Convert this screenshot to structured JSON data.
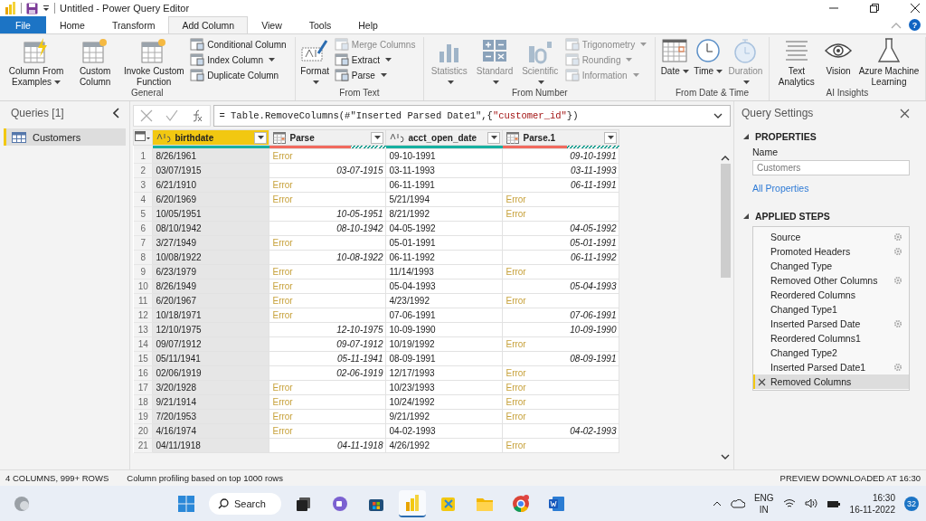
{
  "window": {
    "title": "Untitled - Power Query Editor",
    "help_label": "?"
  },
  "tabs": [
    {
      "label": "File",
      "selected": false,
      "kind": "file"
    },
    {
      "label": "Home",
      "selected": false,
      "kind": "tab"
    },
    {
      "label": "Transform",
      "selected": false,
      "kind": "tab"
    },
    {
      "label": "Add Column",
      "selected": true,
      "kind": "tab"
    },
    {
      "label": "View",
      "selected": false,
      "kind": "tab"
    },
    {
      "label": "Tools",
      "selected": false,
      "kind": "tab"
    },
    {
      "label": "Help",
      "selected": false,
      "kind": "tab"
    }
  ],
  "ribbon": [
    {
      "label": "General",
      "items": [
        {
          "kind": "large",
          "label": "Column From Examples",
          "dropdown": true,
          "disabled": false
        },
        {
          "kind": "large",
          "label": "Custom Column",
          "dropdown": false,
          "disabled": false
        },
        {
          "kind": "large",
          "label": "Invoke Custom Function",
          "dropdown": false,
          "disabled": false
        },
        {
          "kind": "stack",
          "items": [
            {
              "label": "Conditional Column",
              "dropdown": false,
              "disabled": false
            },
            {
              "label": "Index Column",
              "dropdown": true,
              "disabled": false
            },
            {
              "label": "Duplicate Column",
              "dropdown": false,
              "disabled": false
            }
          ]
        }
      ]
    },
    {
      "label": "From Text",
      "items": [
        {
          "kind": "large",
          "label": "Format",
          "dropdown": true,
          "disabled": false
        },
        {
          "kind": "stack",
          "items": [
            {
              "label": "Merge Columns",
              "dropdown": false,
              "disabled": true
            },
            {
              "label": "Extract",
              "dropdown": true,
              "disabled": false
            },
            {
              "label": "Parse",
              "dropdown": true,
              "disabled": false
            }
          ]
        }
      ]
    },
    {
      "label": "From Number",
      "items": [
        {
          "kind": "large",
          "label": "Statistics",
          "dropdown": true,
          "disabled": true
        },
        {
          "kind": "large",
          "label": "Standard",
          "dropdown": true,
          "disabled": true
        },
        {
          "kind": "large",
          "label": "Scientific",
          "dropdown": true,
          "disabled": true
        },
        {
          "kind": "stack",
          "items": [
            {
              "label": "Trigonometry",
              "dropdown": true,
              "disabled": true
            },
            {
              "label": "Rounding",
              "dropdown": true,
              "disabled": true
            },
            {
              "label": "Information",
              "dropdown": true,
              "disabled": true
            }
          ]
        }
      ]
    },
    {
      "label": "From Date & Time",
      "items": [
        {
          "kind": "large",
          "label": "Date",
          "dropdown": true,
          "disabled": false
        },
        {
          "kind": "large",
          "label": "Time",
          "dropdown": true,
          "disabled": false
        },
        {
          "kind": "large",
          "label": "Duration",
          "dropdown": true,
          "disabled": true
        }
      ]
    },
    {
      "label": "AI Insights",
      "items": [
        {
          "kind": "large",
          "label": "Text Analytics",
          "dropdown": false,
          "disabled": false
        },
        {
          "kind": "large",
          "label": "Vision",
          "dropdown": false,
          "disabled": false
        },
        {
          "kind": "large",
          "label": "Azure Machine Learning",
          "dropdown": false,
          "disabled": false
        }
      ]
    }
  ],
  "queries": {
    "title": "Queries [1]",
    "items": [
      {
        "label": "Customers",
        "selected": true
      }
    ]
  },
  "formula": [
    {
      "text": "= Table.RemoveColumns(#\"Inserted Parsed Date1\",{",
      "kind": "code"
    },
    {
      "text": "\"customer_id\"",
      "kind": "string"
    },
    {
      "text": "})",
      "kind": "code"
    }
  ],
  "table": {
    "columns": [
      {
        "name": "birthdate",
        "selected": true,
        "quality": {
          "kind": "valid",
          "level": 1
        }
      },
      {
        "name": "Parse",
        "selected": false,
        "quality": {
          "kind": "error",
          "level": 0.7
        }
      },
      {
        "name": "acct_open_date",
        "selected": false,
        "quality": {
          "kind": "valid",
          "level": 1
        }
      },
      {
        "name": "Parse.1",
        "selected": false,
        "quality": {
          "kind": "error",
          "level": 0.55
        }
      }
    ],
    "rows": [
      {
        "index": "1",
        "cells": [
          {
            "text": "8/26/1961",
            "kind": "text"
          },
          {
            "text": "Error",
            "kind": "error"
          },
          {
            "text": "09-10-1991",
            "kind": "text"
          },
          {
            "text": "09-10-1991",
            "kind": "date"
          }
        ]
      },
      {
        "index": "2",
        "cells": [
          {
            "text": "03/07/1915",
            "kind": "text"
          },
          {
            "text": "03-07-1915",
            "kind": "date"
          },
          {
            "text": "03-11-1993",
            "kind": "text"
          },
          {
            "text": "03-11-1993",
            "kind": "date"
          }
        ]
      },
      {
        "index": "3",
        "cells": [
          {
            "text": "6/21/1910",
            "kind": "text"
          },
          {
            "text": "Error",
            "kind": "error"
          },
          {
            "text": "06-11-1991",
            "kind": "text"
          },
          {
            "text": "06-11-1991",
            "kind": "date"
          }
        ]
      },
      {
        "index": "4",
        "cells": [
          {
            "text": "6/20/1969",
            "kind": "text"
          },
          {
            "text": "Error",
            "kind": "error"
          },
          {
            "text": "5/21/1994",
            "kind": "text"
          },
          {
            "text": "Error",
            "kind": "error"
          }
        ]
      },
      {
        "index": "5",
        "cells": [
          {
            "text": "10/05/1951",
            "kind": "text"
          },
          {
            "text": "10-05-1951",
            "kind": "date"
          },
          {
            "text": "8/21/1992",
            "kind": "text"
          },
          {
            "text": "Error",
            "kind": "error"
          }
        ]
      },
      {
        "index": "6",
        "cells": [
          {
            "text": "08/10/1942",
            "kind": "text"
          },
          {
            "text": "08-10-1942",
            "kind": "date"
          },
          {
            "text": "04-05-1992",
            "kind": "text"
          },
          {
            "text": "04-05-1992",
            "kind": "date"
          }
        ]
      },
      {
        "index": "7",
        "cells": [
          {
            "text": "3/27/1949",
            "kind": "text"
          },
          {
            "text": "Error",
            "kind": "error"
          },
          {
            "text": "05-01-1991",
            "kind": "text"
          },
          {
            "text": "05-01-1991",
            "kind": "date"
          }
        ]
      },
      {
        "index": "8",
        "cells": [
          {
            "text": "10/08/1922",
            "kind": "text"
          },
          {
            "text": "10-08-1922",
            "kind": "date"
          },
          {
            "text": "06-11-1992",
            "kind": "text"
          },
          {
            "text": "06-11-1992",
            "kind": "date"
          }
        ]
      },
      {
        "index": "9",
        "cells": [
          {
            "text": "6/23/1979",
            "kind": "text"
          },
          {
            "text": "Error",
            "kind": "error"
          },
          {
            "text": "11/14/1993",
            "kind": "text"
          },
          {
            "text": "Error",
            "kind": "error"
          }
        ]
      },
      {
        "index": "10",
        "cells": [
          {
            "text": "8/26/1949",
            "kind": "text"
          },
          {
            "text": "Error",
            "kind": "error"
          },
          {
            "text": "05-04-1993",
            "kind": "text"
          },
          {
            "text": "05-04-1993",
            "kind": "date"
          }
        ]
      },
      {
        "index": "11",
        "cells": [
          {
            "text": "6/20/1967",
            "kind": "text"
          },
          {
            "text": "Error",
            "kind": "error"
          },
          {
            "text": "4/23/1992",
            "kind": "text"
          },
          {
            "text": "Error",
            "kind": "error"
          }
        ]
      },
      {
        "index": "12",
        "cells": [
          {
            "text": "10/18/1971",
            "kind": "text"
          },
          {
            "text": "Error",
            "kind": "error"
          },
          {
            "text": "07-06-1991",
            "kind": "text"
          },
          {
            "text": "07-06-1991",
            "kind": "date"
          }
        ]
      },
      {
        "index": "13",
        "cells": [
          {
            "text": "12/10/1975",
            "kind": "text"
          },
          {
            "text": "12-10-1975",
            "kind": "date"
          },
          {
            "text": "10-09-1990",
            "kind": "text"
          },
          {
            "text": "10-09-1990",
            "kind": "date"
          }
        ]
      },
      {
        "index": "14",
        "cells": [
          {
            "text": "09/07/1912",
            "kind": "text"
          },
          {
            "text": "09-07-1912",
            "kind": "date"
          },
          {
            "text": "10/19/1992",
            "kind": "text"
          },
          {
            "text": "Error",
            "kind": "error"
          }
        ]
      },
      {
        "index": "15",
        "cells": [
          {
            "text": "05/11/1941",
            "kind": "text"
          },
          {
            "text": "05-11-1941",
            "kind": "date"
          },
          {
            "text": "08-09-1991",
            "kind": "text"
          },
          {
            "text": "08-09-1991",
            "kind": "date"
          }
        ]
      },
      {
        "index": "16",
        "cells": [
          {
            "text": "02/06/1919",
            "kind": "text"
          },
          {
            "text": "02-06-1919",
            "kind": "date"
          },
          {
            "text": "12/17/1993",
            "kind": "text"
          },
          {
            "text": "Error",
            "kind": "error"
          }
        ]
      },
      {
        "index": "17",
        "cells": [
          {
            "text": "3/20/1928",
            "kind": "text"
          },
          {
            "text": "Error",
            "kind": "error"
          },
          {
            "text": "10/23/1993",
            "kind": "text"
          },
          {
            "text": "Error",
            "kind": "error"
          }
        ]
      },
      {
        "index": "18",
        "cells": [
          {
            "text": "9/21/1914",
            "kind": "text"
          },
          {
            "text": "Error",
            "kind": "error"
          },
          {
            "text": "10/24/1992",
            "kind": "text"
          },
          {
            "text": "Error",
            "kind": "error"
          }
        ]
      },
      {
        "index": "19",
        "cells": [
          {
            "text": "7/20/1953",
            "kind": "text"
          },
          {
            "text": "Error",
            "kind": "error"
          },
          {
            "text": "9/21/1992",
            "kind": "text"
          },
          {
            "text": "Error",
            "kind": "error"
          }
        ]
      },
      {
        "index": "20",
        "cells": [
          {
            "text": "4/16/1974",
            "kind": "text"
          },
          {
            "text": "Error",
            "kind": "error"
          },
          {
            "text": "04-02-1993",
            "kind": "text"
          },
          {
            "text": "04-02-1993",
            "kind": "date"
          }
        ]
      },
      {
        "index": "21",
        "cells": [
          {
            "text": "04/11/1918",
            "kind": "text"
          },
          {
            "text": "04-11-1918",
            "kind": "date"
          },
          {
            "text": "4/26/1992",
            "kind": "text"
          },
          {
            "text": "Error",
            "kind": "error"
          }
        ]
      }
    ]
  },
  "settings": {
    "title": "Query Settings",
    "properties_heading": "PROPERTIES",
    "name_label": "Name",
    "name_value": "Customers",
    "all_properties": "All Properties",
    "steps_heading": "APPLIED STEPS",
    "steps": [
      {
        "label": "Source",
        "gear": true,
        "selected": false
      },
      {
        "label": "Promoted Headers",
        "gear": true,
        "selected": false
      },
      {
        "label": "Changed Type",
        "gear": false,
        "selected": false
      },
      {
        "label": "Removed Other Columns",
        "gear": true,
        "selected": false
      },
      {
        "label": "Reordered Columns",
        "gear": false,
        "selected": false
      },
      {
        "label": "Changed Type1",
        "gear": false,
        "selected": false
      },
      {
        "label": "Inserted Parsed Date",
        "gear": true,
        "selected": false
      },
      {
        "label": "Reordered Columns1",
        "gear": false,
        "selected": false
      },
      {
        "label": "Changed Type2",
        "gear": false,
        "selected": false
      },
      {
        "label": "Inserted Parsed Date1",
        "gear": true,
        "selected": false
      },
      {
        "label": "Removed Columns",
        "gear": false,
        "selected": true
      }
    ]
  },
  "status_bar": {
    "left": [
      "4 COLUMNS, 999+ ROWS",
      "Column profiling based on top 1000 rows"
    ],
    "right": "PREVIEW DOWNLOADED AT 16:30"
  },
  "taskbar": {
    "search": "Search",
    "apps": [
      {
        "active": false
      },
      {
        "active": false
      },
      {
        "active": false
      },
      {
        "active": false
      },
      {
        "active": true
      },
      {
        "active": false
      },
      {
        "active": false
      },
      {
        "active": false
      },
      {
        "active": false
      }
    ],
    "language": [
      "ENG",
      "IN"
    ],
    "time": "16:30",
    "date": "16-11-2022",
    "badge": "32"
  }
}
